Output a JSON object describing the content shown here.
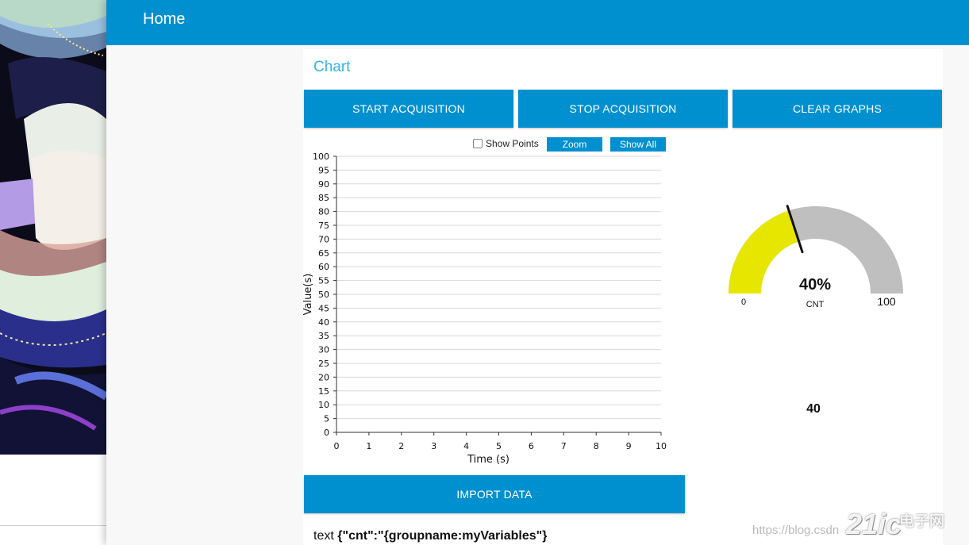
{
  "header": {
    "title": "Home"
  },
  "card": {
    "title": "Chart"
  },
  "buttons": {
    "start": "START ACQUISITION",
    "stop": "STOP ACQUISITION",
    "clear": "CLEAR GRAPHS",
    "import": "IMPORT DATA"
  },
  "chart_controls": {
    "show_points_label": "Show Points",
    "show_points_checked": false,
    "zoom_label": "Zoom",
    "show_all_label": "Show All"
  },
  "chart_data": {
    "type": "line",
    "xlabel": "Time (s)",
    "ylabel": "Value(s)",
    "xlim": [
      0,
      10
    ],
    "ylim": [
      0,
      100
    ],
    "xticks": [
      0,
      1,
      2,
      3,
      4,
      5,
      6,
      7,
      8,
      9,
      10
    ],
    "yticks": [
      0,
      5,
      10,
      15,
      20,
      25,
      30,
      35,
      40,
      45,
      50,
      55,
      60,
      65,
      70,
      75,
      80,
      85,
      90,
      95,
      100
    ],
    "grid": true,
    "series": []
  },
  "gauge": {
    "value_text": "40%",
    "value": 40,
    "min": 0,
    "max": 100,
    "label": "CNT",
    "fill_color": "#e6e600",
    "track_color": "#bfbfbf",
    "needle_color": "#111111"
  },
  "gauge_number": "40",
  "import": {
    "prefix": "text",
    "json_text": "{\"cnt\":\"{groupname:myVariables\"}"
  },
  "watermark": {
    "url": "https://blog.csdn",
    "logo": "21ic",
    "logo_cn": "电子网"
  },
  "colors": {
    "primary": "#0090cf",
    "title_accent": "#33b5e5"
  }
}
